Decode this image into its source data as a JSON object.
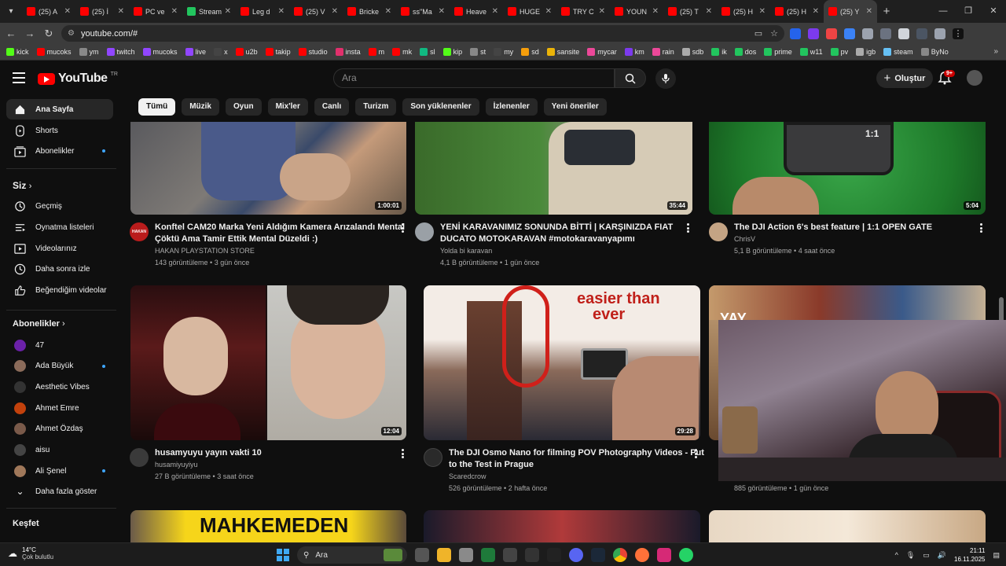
{
  "browser": {
    "tabs": [
      {
        "label": "(25) A",
        "color": "#ff0000"
      },
      {
        "label": "(25) İ",
        "color": "#ff0000"
      },
      {
        "label": "PC ve",
        "color": "#ff0000"
      },
      {
        "label": "Stream",
        "color": "#22c55e"
      },
      {
        "label": "Leg d",
        "color": "#ff0000"
      },
      {
        "label": "(25) V",
        "color": "#ff0000"
      },
      {
        "label": "Bricke",
        "color": "#ff0000"
      },
      {
        "label": "ss\"Ma",
        "color": "#ff0000"
      },
      {
        "label": "Heave",
        "color": "#ff0000"
      },
      {
        "label": "HUGE",
        "color": "#ff0000"
      },
      {
        "label": "TRY C",
        "color": "#ff0000"
      },
      {
        "label": "YOUN",
        "color": "#ff0000"
      },
      {
        "label": "(25) T",
        "color": "#ff0000"
      },
      {
        "label": "(25) H",
        "color": "#ff0000"
      },
      {
        "label": "(25) H",
        "color": "#ff0000"
      },
      {
        "label": "(25) Y",
        "color": "#ff0000"
      }
    ],
    "url": "youtube.com/#",
    "bookmarks": [
      {
        "label": "kick",
        "color": "#53fc18"
      },
      {
        "label": "mucoks",
        "color": "#ff0000"
      },
      {
        "label": "ym",
        "color": "#888888"
      },
      {
        "label": "twitch",
        "color": "#9146ff"
      },
      {
        "label": "mucoks",
        "color": "#9146ff"
      },
      {
        "label": "live",
        "color": "#9146ff"
      },
      {
        "label": "x",
        "color": "#444444"
      },
      {
        "label": "u2b",
        "color": "#ff0000"
      },
      {
        "label": "takip",
        "color": "#ff0000"
      },
      {
        "label": "studio",
        "color": "#ff0000"
      },
      {
        "label": "insta",
        "color": "#e1306c"
      },
      {
        "label": "m",
        "color": "#ff0000"
      },
      {
        "label": "mk",
        "color": "#ff0000"
      },
      {
        "label": "sl",
        "color": "#10b981"
      },
      {
        "label": "kip",
        "color": "#53fc18"
      },
      {
        "label": "st",
        "color": "#888888"
      },
      {
        "label": "my",
        "color": "#444444"
      },
      {
        "label": "sd",
        "color": "#f59e0b"
      },
      {
        "label": "sansite",
        "color": "#eab308"
      },
      {
        "label": "mycar",
        "color": "#ec4899"
      },
      {
        "label": "km",
        "color": "#7c3aed"
      },
      {
        "label": "rain",
        "color": "#ec4899"
      },
      {
        "label": "sdb",
        "color": "#aaaaaa"
      },
      {
        "label": "ik",
        "color": "#22c55e"
      },
      {
        "label": "dos",
        "color": "#22c55e"
      },
      {
        "label": "prime",
        "color": "#22c55e"
      },
      {
        "label": "w11",
        "color": "#22c55e"
      },
      {
        "label": "pv",
        "color": "#22c55e"
      },
      {
        "label": "igb",
        "color": "#aaaaaa"
      },
      {
        "label": "steam",
        "color": "#66c0f4"
      },
      {
        "label": "ByNo",
        "color": "#888888"
      }
    ]
  },
  "header": {
    "logo": "YouTube",
    "region": "TR",
    "search_placeholder": "Ara",
    "create_label": "Oluştur",
    "notif_badge": "9+"
  },
  "chips": [
    "Tümü",
    "Müzik",
    "Oyun",
    "Mix'ler",
    "Canlı",
    "Turizm",
    "Son yüklenenler",
    "İzlenenler",
    "Yeni öneriler"
  ],
  "sidebar": {
    "main": [
      {
        "label": "Ana Sayfa"
      },
      {
        "label": "Shorts"
      },
      {
        "label": "Abonelikler"
      }
    ],
    "you_heading": "Siz",
    "you": [
      {
        "label": "Geçmiş"
      },
      {
        "label": "Oynatma listeleri"
      },
      {
        "label": "Videolarınız"
      },
      {
        "label": "Daha sonra izle"
      },
      {
        "label": "Beğendiğim videolar"
      }
    ],
    "subs_heading": "Abonelikler",
    "subs": [
      {
        "label": "47",
        "color": "#6b21a8"
      },
      {
        "label": "Ada Büyük",
        "color": "#8b6b5a"
      },
      {
        "label": "Aesthetic Vibes",
        "color": "#333333"
      },
      {
        "label": "Ahmet Emre",
        "color": "#c2410c"
      },
      {
        "label": "Ahmet Özdaş",
        "color": "#7a5a4a"
      },
      {
        "label": "aisu",
        "color": "#444444"
      },
      {
        "label": "Ali Şenel",
        "color": "#a0785a"
      }
    ],
    "more_label": "Daha fazla göster",
    "explore_heading": "Keşfet"
  },
  "videos": [
    {
      "title1": "Konftel CAM20 Marka Yeni Aldığım Kamera Arızalandı Mental",
      "title2": "Çöktü Ama Tamir Ettik Mental Düzeldi :)",
      "channel": "HAKAN PLAYSTATION STORE",
      "meta": "143 görüntüleme • 3 gün önce",
      "duration": "1:00:01"
    },
    {
      "title1": "YENİ KARAVANIMIZ SONUNDA BİTTİ | KARŞINIZDA FIAT",
      "title2": "DUCATO MOTOKARAVAN #motokaravanyapımı",
      "channel": "Yolda bi karavan",
      "meta": "4,1 B görüntüleme • 1 gün önce",
      "duration": "35:44"
    },
    {
      "title1": "The DJI Action 6's best feature | 1:1 OPEN GATE",
      "title2": "",
      "channel": "ChrisV",
      "meta": "5,1 B görüntüleme • 4 saat önce",
      "duration": "5:04"
    },
    {
      "title1": "husamyuyu yayın vakti 10",
      "title2": "",
      "channel": "husamiyuyiyu",
      "meta": "27 B görüntüleme • 3 saat önce",
      "duration": "12:04"
    },
    {
      "title1": "The DJI Osmo Nano for filming POV Photography Videos - Put",
      "title2": "to the Test in Prague",
      "channel": "Scaredcrow",
      "meta": "526 görüntüleme • 2 hafta önce",
      "duration": "29:28"
    },
    {
      "title1": "",
      "title2": "",
      "channel": "",
      "meta": "885 görüntüleme • 1 gün önce",
      "duration": ""
    }
  ],
  "thumb_text": {
    "ratio": "1:1",
    "easier": "easier than",
    "ever": "ever",
    "mahkeme": "MAHKEMEDEN",
    "yay": "YAY",
    "hakan_av": "HAKAN"
  },
  "taskbar": {
    "temp": "14°C",
    "weather": "Çok bulutlu",
    "search": "Ara",
    "time": "21:11",
    "date": "16.11.2025"
  }
}
